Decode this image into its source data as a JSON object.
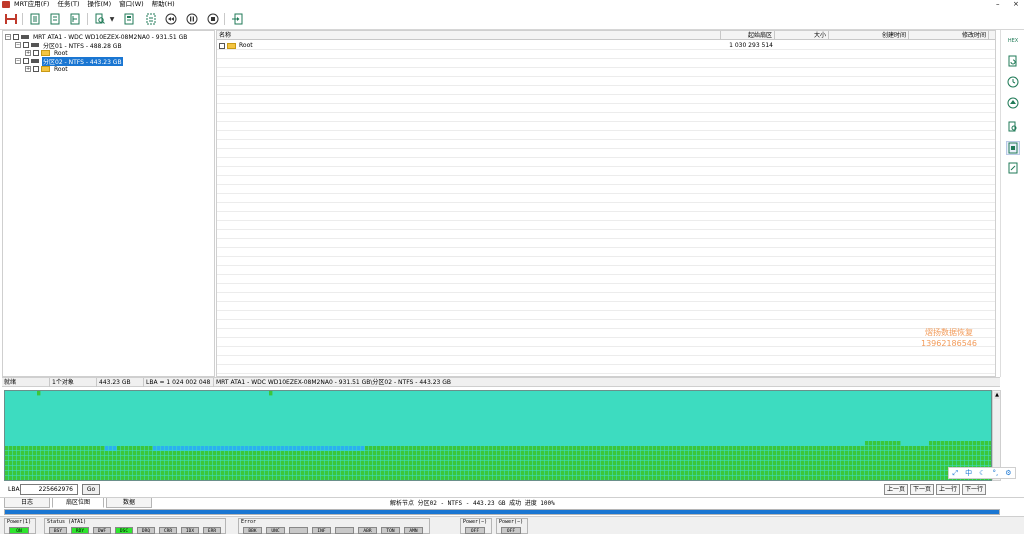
{
  "menu": {
    "items": [
      "MRT应用(F)",
      "任务(T)",
      "操作(M)",
      "窗口(W)",
      "帮助(H)"
    ],
    "minimize": "–",
    "close": "×"
  },
  "toolbar": {
    "buttons": [
      {
        "icon": "disk-connect-icon"
      },
      {
        "icon": "doc-scan-icon"
      },
      {
        "icon": "doc-list-icon"
      },
      {
        "icon": "doc-tree-icon"
      },
      {
        "icon": "doc-search-icon"
      },
      {
        "icon": "dropdown-arrow-icon"
      },
      {
        "icon": "doc-report-icon"
      },
      {
        "icon": "doc-export-icon"
      },
      {
        "icon": "rewind-icon"
      },
      {
        "icon": "pause-icon"
      },
      {
        "icon": "stop-icon"
      },
      {
        "icon": "exit-icon"
      }
    ]
  },
  "tree": {
    "disk": "MRT ATA1 - WDC WD10EZEX-08M2NA0 - 931.51 GB",
    "partition1": "分区01 - NTFS - 488.28 GB",
    "partition1_root": "Root",
    "partition2": "分区02 - NTFS - 443.23 GB",
    "partition2_root": "Root",
    "collapse_glyph": "−",
    "expand_glyph": "+"
  },
  "list": {
    "columns": [
      "名称",
      "起始扇区",
      "大小",
      "创建时间",
      "修改时间"
    ],
    "rows": [
      {
        "name": "Root",
        "start_sector": "1 030 293 514",
        "size": "",
        "created": "",
        "modified": ""
      }
    ]
  },
  "watermark": {
    "line1": "熠扬数据恢复",
    "line2": "13962186546"
  },
  "right_bar": {
    "buttons": [
      "hex-icon",
      "doc-refresh-icon",
      "clock-icon",
      "up-circle-icon",
      "doc-search-icon",
      "doc-image-icon",
      "doc-edit-icon"
    ]
  },
  "status": {
    "state": "就绪",
    "object_count": "1个对象",
    "size": "443.23 GB",
    "lba": "LBA = 1 024 002 048",
    "path": "MRT ATA1 - WDC WD10EZEX-08M2NA0 - 931.51 GB\\分区02 - NTFS - 443.23 GB"
  },
  "ime": {
    "items": [
      "⤢",
      "中",
      "☾",
      "°,",
      "⚙"
    ]
  },
  "lba_box": {
    "label": "LBA",
    "value": "225662976",
    "go": "Go"
  },
  "nav": {
    "prev_page": "上一页",
    "next_page": "下一页",
    "prev_row": "上一行",
    "next_row": "下一行"
  },
  "tabs": [
    "日志",
    "扇区位图",
    "数据"
  ],
  "parse_status": "解析节点 分区02 - NTFS - 443.23 GB 成功 进度 100%",
  "progress": {
    "percent": 100
  },
  "registers": {
    "power1": {
      "title": "Power(1)",
      "leds": [
        {
          "label": "ON",
          "on": true
        }
      ]
    },
    "status": {
      "title": "Status (ATA1)",
      "leds": [
        {
          "label": "BSY",
          "on": false
        },
        {
          "label": "RDY",
          "on": true
        },
        {
          "label": "DWF",
          "on": false
        },
        {
          "label": "DSC",
          "on": true
        },
        {
          "label": "DRQ",
          "on": false
        },
        {
          "label": "CRR",
          "on": false
        },
        {
          "label": "IDX",
          "on": false
        },
        {
          "label": "ERR",
          "on": false
        }
      ]
    },
    "error": {
      "title": "Error",
      "leds": [
        {
          "label": "BBK",
          "on": false
        },
        {
          "label": "UNC",
          "on": false
        },
        {
          "label": "",
          "on": false
        },
        {
          "label": "INF",
          "on": false
        },
        {
          "label": "",
          "on": false
        },
        {
          "label": "ABR",
          "on": false
        },
        {
          "label": "TON",
          "on": false
        },
        {
          "label": "AMN",
          "on": false
        }
      ]
    },
    "power2": {
      "title": "Power(−)",
      "leds": [
        {
          "label": "OFF",
          "on": false
        }
      ]
    },
    "power3": {
      "title": "Power(−)",
      "leds": [
        {
          "label": "OFF",
          "on": false
        }
      ]
    }
  },
  "colors": {
    "map_cyan": "#3ddcc0",
    "map_green": "#3bc63b",
    "map_blue": "#2bb0f0",
    "selection": "#1a76d2",
    "led_on": "#2ee62e"
  }
}
